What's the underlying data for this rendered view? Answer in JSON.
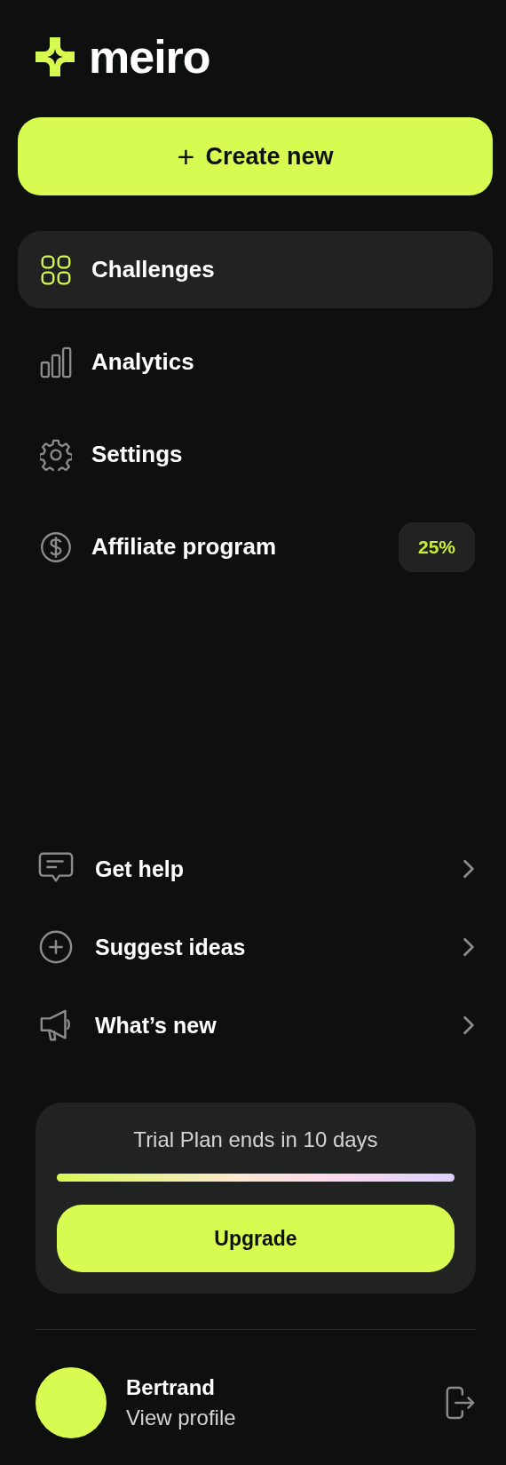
{
  "logo": {
    "text": "meiro"
  },
  "create_button": {
    "icon": "+",
    "label": "Create new"
  },
  "nav": {
    "items": [
      {
        "label": "Challenges",
        "selected": true
      },
      {
        "label": "Analytics",
        "selected": false
      },
      {
        "label": "Settings",
        "selected": false
      },
      {
        "label": "Affiliate program",
        "selected": false,
        "badge": "25%"
      }
    ]
  },
  "support": {
    "items": [
      {
        "label": "Get help"
      },
      {
        "label": "Suggest ideas"
      },
      {
        "label": "What’s new"
      }
    ]
  },
  "trial_card": {
    "text": "Trial Plan ends in 10 days",
    "level": 1,
    "button": "Upgrade"
  },
  "profile": {
    "name": "Bertrand",
    "link": "View profile"
  }
}
